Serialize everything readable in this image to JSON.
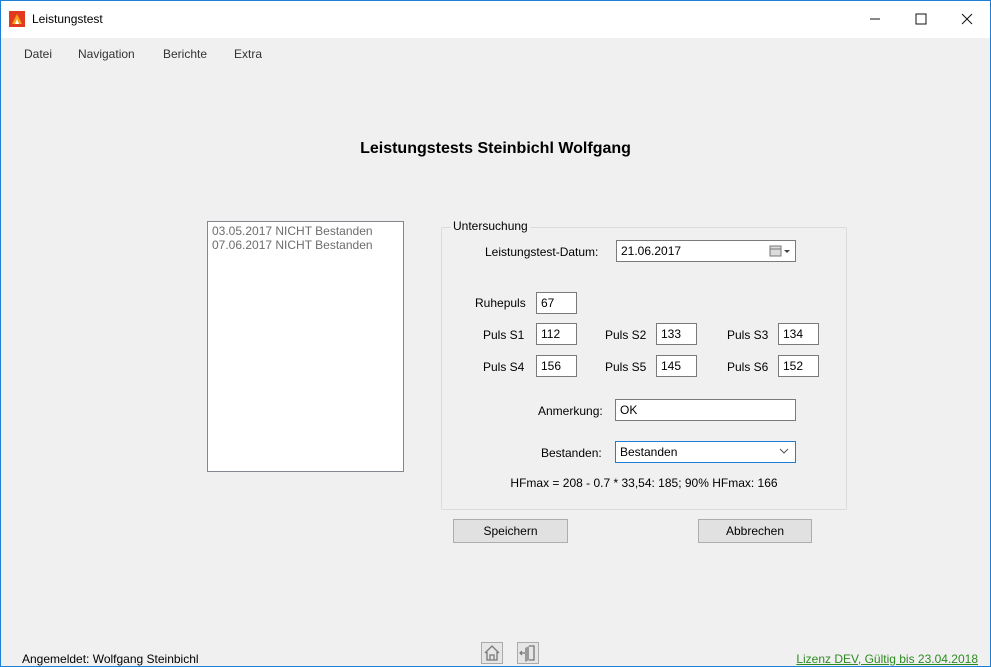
{
  "window": {
    "title": "Leistungstest",
    "controls": {
      "minimize": "–",
      "maximize": "☐",
      "close": "✕"
    }
  },
  "menu": [
    "Datei",
    "Navigation",
    "Berichte",
    "Extra"
  ],
  "page_title": "Leistungstests Steinbichl Wolfgang",
  "history_list": [
    "03.05.2017 NICHT Bestanden",
    "07.06.2017 NICHT Bestanden"
  ],
  "form": {
    "group_title": "Untersuchung",
    "date_label": "Leistungstest-Datum:",
    "date_value": "21.06.2017",
    "ruhepuls_label": "Ruhepuls",
    "ruhepuls_value": "67",
    "puls": [
      {
        "label": "Puls S1",
        "value": "112"
      },
      {
        "label": "Puls S2",
        "value": "133"
      },
      {
        "label": "Puls S3",
        "value": "134"
      },
      {
        "label": "Puls S4",
        "value": "156"
      },
      {
        "label": "Puls S5",
        "value": "145"
      },
      {
        "label": "Puls S6",
        "value": "152"
      }
    ],
    "anmerkung_label": "Anmerkung:",
    "anmerkung_value": "OK",
    "bestanden_label": "Bestanden:",
    "bestanden_value": "Bestanden",
    "formula": "HFmax = 208 - 0.7 * 33,54: 185; 90% HFmax: 166"
  },
  "buttons": {
    "save": "Speichern",
    "cancel": "Abbrechen"
  },
  "status": {
    "logged_in": "Angemeldet: Wolfgang Steinbichl",
    "license": "Lizenz DEV, Gültig bis 23.04.2018"
  },
  "footer_icons": [
    "home-icon",
    "exit-door-icon"
  ],
  "colors": {
    "accent": "#1e7fd6",
    "license_link": "#2e8b22"
  }
}
